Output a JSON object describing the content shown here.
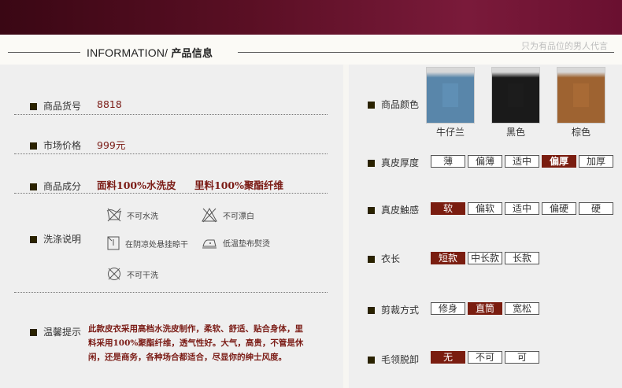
{
  "header": {
    "slogan": "只为有品位的男人代言",
    "title_en": "INFORMATION/",
    "title_cn": "产品信息"
  },
  "left": {
    "item_no": {
      "label": "商品货号",
      "value": "8818"
    },
    "price": {
      "label": "市场价格",
      "value": "999元"
    },
    "material": {
      "label": "商品成分",
      "outer": "面料100%水洗皮",
      "lining": "里料100%聚酯纤维"
    },
    "wash": {
      "label": "洗涤说明",
      "no_wash": "不可水洗",
      "no_bleach": "不可漂白",
      "shade_dry": "在阴凉处悬挂晾干",
      "low_iron": "低温垫布熨烫",
      "no_dryclean": "不可干洗"
    },
    "tips": {
      "label": "温馨提示",
      "text": "此款皮衣采用高档水洗皮制作，柔软、舒适、贴合身体，里料采用100%聚酯纤维，透气性好。大气，高贵，不管是休闲，还是商务，各种场合都适合，尽显你的绅士风度。"
    }
  },
  "right": {
    "colors": {
      "label": "商品颜色",
      "items": [
        {
          "name": "牛仔兰",
          "swatch": "#5f8fb5"
        },
        {
          "name": "黑色",
          "swatch": "#1c1c1c"
        },
        {
          "name": "棕色",
          "swatch": "#a86a35"
        }
      ]
    },
    "thickness": {
      "label": "真皮厚度",
      "options": [
        "薄",
        "偏薄",
        "适中",
        "偏厚",
        "加厚"
      ],
      "selected": 3
    },
    "touch": {
      "label": "真皮触感",
      "options": [
        "软",
        "偏软",
        "适中",
        "偏硬",
        "硬"
      ],
      "selected": 0
    },
    "length": {
      "label": "衣长",
      "options": [
        "短款",
        "中长款",
        "长款"
      ],
      "selected": 0
    },
    "cut": {
      "label": "剪裁方式",
      "options": [
        "修身",
        "直筒",
        "宽松"
      ],
      "selected": 1
    },
    "collar": {
      "label": "毛领脱卸",
      "options": [
        "无",
        "不可",
        "可"
      ],
      "selected": 0
    }
  },
  "colors": {
    "accent": "#7a1d10",
    "banner": "#5a0f24"
  }
}
